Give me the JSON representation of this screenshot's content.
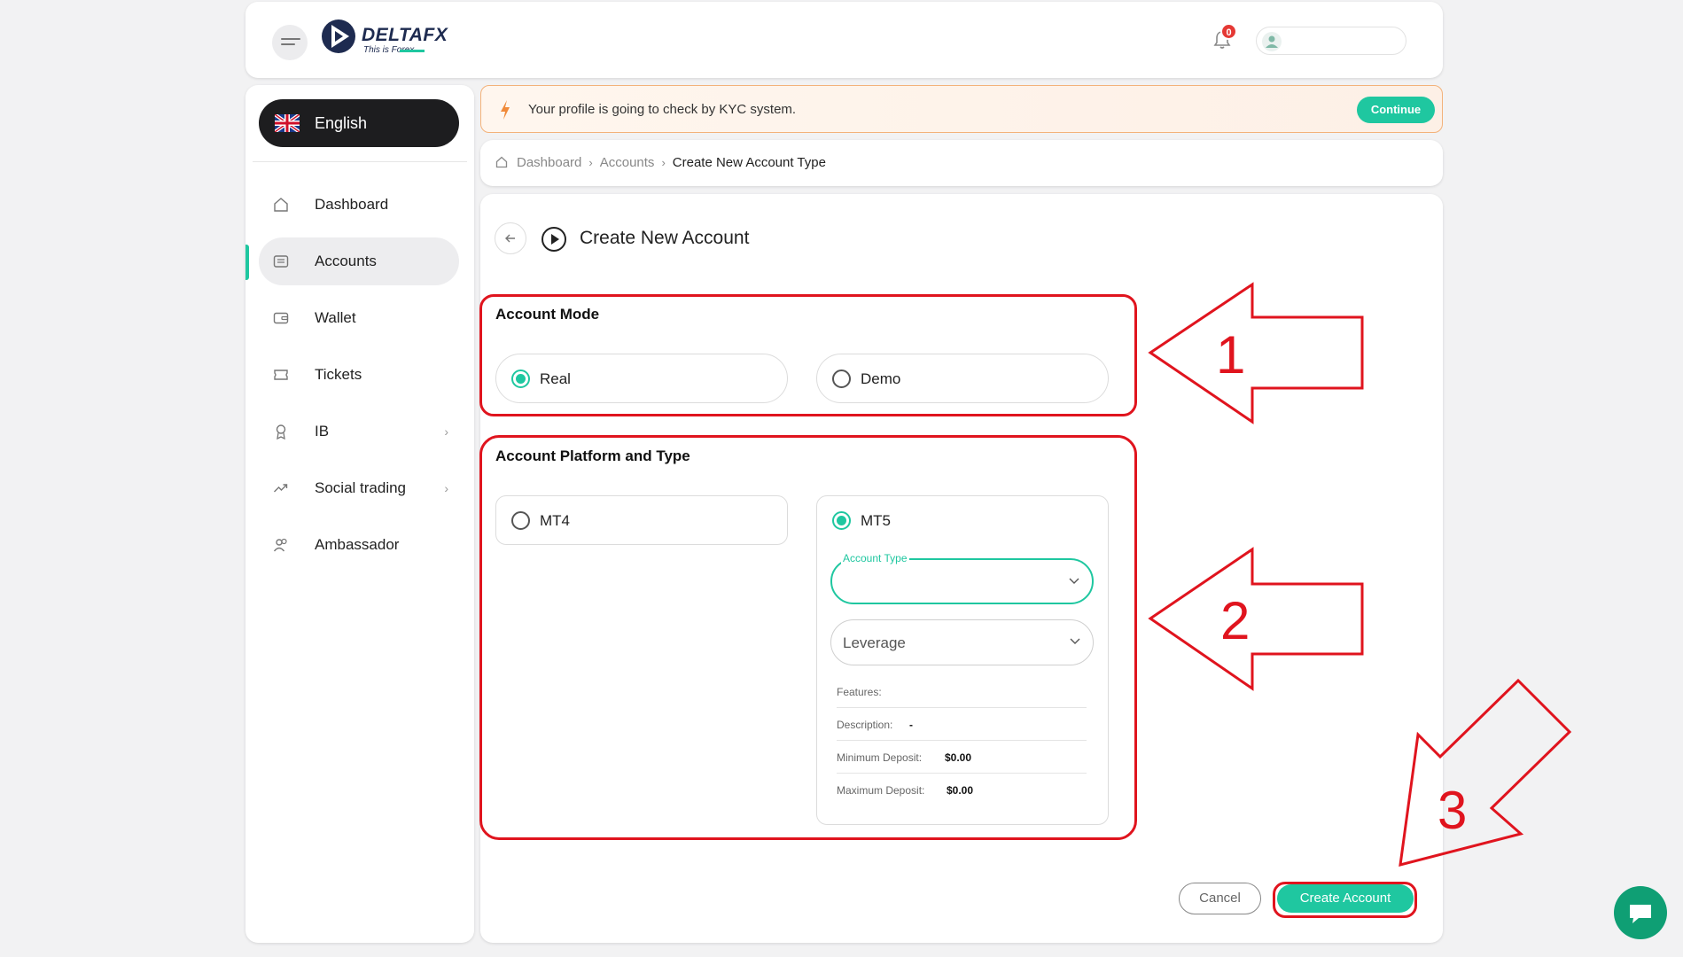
{
  "header": {
    "brand_name": "DELTAFX",
    "brand_tagline": "This is Forex",
    "notification_count": "0",
    "colors": {
      "accent": "#1fc7a0",
      "badge": "#e53935",
      "brand": "#1e2b50"
    }
  },
  "sidebar": {
    "language": "English",
    "items": [
      {
        "label": "Dashboard",
        "icon": "home-icon"
      },
      {
        "label": "Accounts",
        "icon": "accounts-icon",
        "active": true
      },
      {
        "label": "Wallet",
        "icon": "wallet-icon"
      },
      {
        "label": "Tickets",
        "icon": "ticket-icon"
      },
      {
        "label": "IB",
        "icon": "award-icon",
        "has_submenu": true
      },
      {
        "label": "Social trading",
        "icon": "trend-icon",
        "has_submenu": true
      },
      {
        "label": "Ambassador",
        "icon": "users-icon"
      }
    ]
  },
  "kyc": {
    "message": "Your profile is going to check by KYC system.",
    "button": "Continue"
  },
  "breadcrumb": {
    "items": [
      "Dashboard",
      "Accounts"
    ],
    "current": "Create New Account Type"
  },
  "page": {
    "title": "Create New Account",
    "account_mode": {
      "title": "Account Mode",
      "options": [
        {
          "label": "Real",
          "selected": true
        },
        {
          "label": "Demo",
          "selected": false
        }
      ]
    },
    "platform": {
      "title": "Account Platform and Type",
      "options": [
        {
          "label": "MT4",
          "selected": false
        },
        {
          "label": "MT5",
          "selected": true
        }
      ],
      "account_type_label": "Account Type",
      "account_type_value": "",
      "leverage_placeholder": "Leverage",
      "features_label": "Features:",
      "description_label": "Description:",
      "description_value": "-",
      "min_deposit_label": "Minimum Deposit:",
      "min_deposit_value": "$0.00",
      "max_deposit_label": "Maximum Deposit:",
      "max_deposit_value": "$0.00"
    },
    "cancel": "Cancel",
    "create": "Create Account"
  },
  "annotations": [
    "1",
    "2",
    "3"
  ]
}
